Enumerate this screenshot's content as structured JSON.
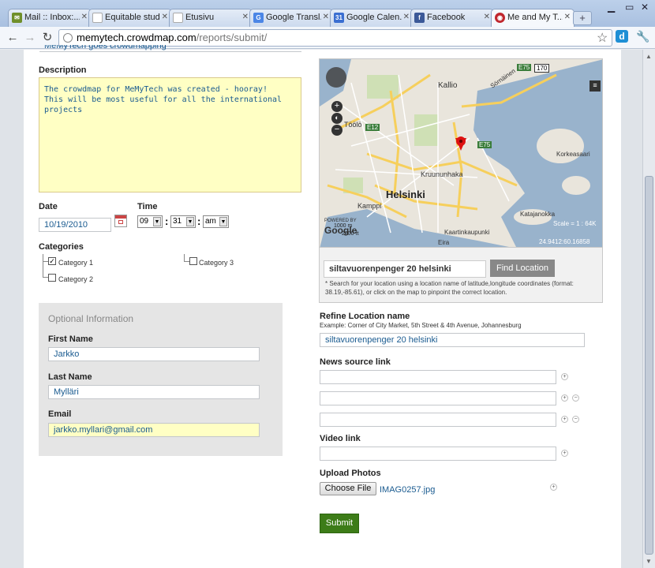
{
  "browser": {
    "tabs": [
      {
        "label": "Mail :: Inbox:...",
        "icon": "mail-icon",
        "color": "#6f8f2a"
      },
      {
        "label": "Equitable stude...",
        "icon": "page-icon",
        "color": "#ffffff"
      },
      {
        "label": "Etusivu",
        "icon": "page-icon",
        "color": "#ffffff"
      },
      {
        "label": "Google Transl...",
        "icon": "google-translate-icon",
        "color": "#4b86e6"
      },
      {
        "label": "Google Calen...",
        "icon": "google-calendar-icon",
        "color": "#3b6fd1"
      },
      {
        "label": "Facebook",
        "icon": "facebook-icon",
        "color": "#3b5998"
      },
      {
        "label": "Me and My T...",
        "icon": "crowdmap-icon",
        "color": "#c0272d"
      }
    ],
    "url_host": "memytech.crowdmap.com",
    "url_path": "/reports/submit/"
  },
  "form": {
    "title_fragment": "MeMyTech goes crowdmapping",
    "description_label": "Description",
    "description_value": "The crowdmap for MeMyTech was created - hooray!\nThis will be most useful for all the international\nprojects",
    "date_label": "Date",
    "date_value": "10/19/2010",
    "time_label": "Time",
    "time_hour": "09",
    "time_minute": "31",
    "time_ampm": "am",
    "categories_label": "Categories",
    "categories": [
      {
        "label": "Category 1",
        "checked": true
      },
      {
        "label": "Category 2",
        "checked": false
      },
      {
        "label": "Category 3",
        "checked": false
      }
    ],
    "optional_title": "Optional Information",
    "first_name_label": "First Name",
    "first_name_value": "Jarkko",
    "last_name_label": "Last Name",
    "last_name_value": "Mylläri",
    "email_label": "Email",
    "email_value": "jarkko.myllari@gmail.com"
  },
  "map": {
    "labels": {
      "kallio": "Kallio",
      "helsinki": "Helsinki",
      "kruununhaka": "Kruununhaka",
      "toolo": "Töölö",
      "kamppi": "Kamppi",
      "katajanokka": "Katajanokka",
      "korkeasaari": "Korkeasaari",
      "kaartinkaupunki": "Kaartinkaupunki",
      "eira": "Eira",
      "sornainen": "Sörnäinen",
      "e12": "E12",
      "e75": "E75",
      "e75b": "E75",
      "road170": "170"
    },
    "scale": "Scale = 1 : 64K",
    "scale_m": "1000 m",
    "scale_ft": "2000 ft",
    "coords": "24.9412:60.16858",
    "powered_by": "POWERED BY",
    "google": "Google",
    "location_input": "siltavuorenpenger 20 helsinki",
    "find_button": "Find Location",
    "hint": "* Search for your location using a location name of latitude,longitude coordinates (format: 38.19,-85.61), or click on the map to pinpoint the correct location."
  },
  "right": {
    "refine_label": "Refine Location name",
    "refine_example": "Example: Corner of City Market, 5th Street & 4th Avenue, Johannesburg",
    "refine_value": "siltavuorenpenger 20 helsinki",
    "news_label": "News source link",
    "video_label": "Video link",
    "upload_label": "Upload Photos",
    "choose_file": "Choose File",
    "file_name": "IMAG0257.jpg",
    "submit": "Submit"
  }
}
